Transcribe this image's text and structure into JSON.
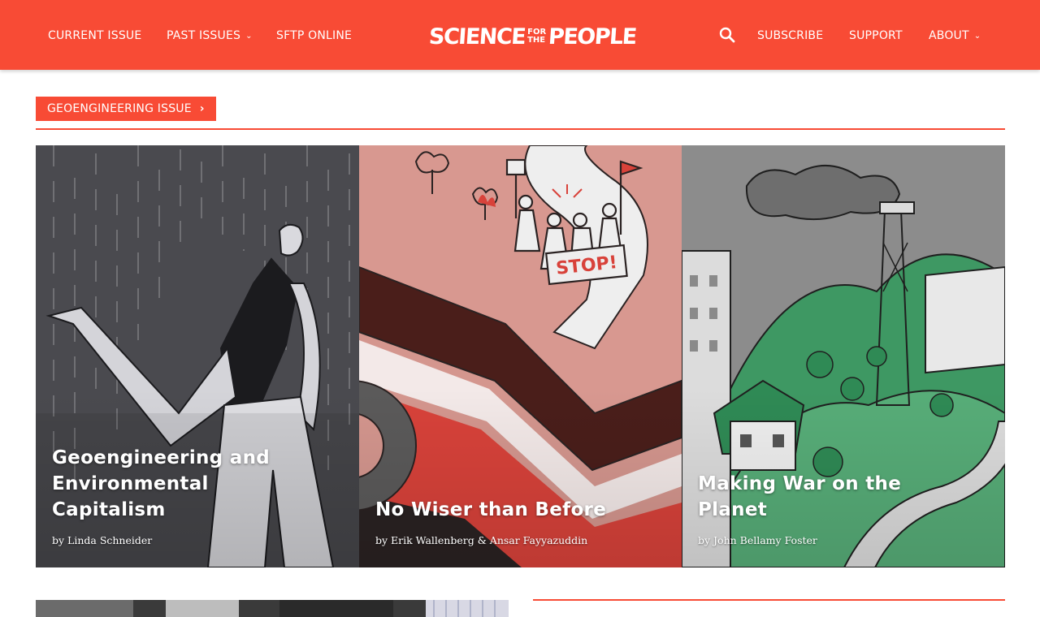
{
  "nav": {
    "left": [
      {
        "label": "CURRENT ISSUE",
        "dropdown": false
      },
      {
        "label": "PAST ISSUES",
        "dropdown": true
      },
      {
        "label": "SFTP ONLINE",
        "dropdown": false
      }
    ],
    "right": [
      {
        "label": "SUBSCRIBE",
        "dropdown": false
      },
      {
        "label": "SUPPORT",
        "dropdown": false
      },
      {
        "label": "ABOUT",
        "dropdown": true
      }
    ],
    "logo": {
      "word1": "SCIENCE",
      "small1": "FOR",
      "small2": "THE",
      "word2": "PEOPLE"
    },
    "search_icon": "search-icon",
    "chevron_icon": "chevron-down-icon"
  },
  "section": {
    "label": "GEOENGINEERING ISSUE",
    "arrow_icon": "chevron-right-icon"
  },
  "cards": [
    {
      "title": "Geoengineering and Environmental Capitalism",
      "author": "by Linda Schneider"
    },
    {
      "title": "No Wiser than Before",
      "author": "by Erik Wallenberg & Ansar Fayyazuddin",
      "sign_text": "STOP!"
    },
    {
      "title": "Making War on the Planet",
      "author": "by John Bellamy Foster"
    }
  ],
  "colors": {
    "brand": "#f84b35",
    "card1_bg": "#4a4a4f",
    "card2_bg": "#d4968e",
    "card3_bg": "#8c8c8c",
    "accent_green": "#2f8a55"
  }
}
